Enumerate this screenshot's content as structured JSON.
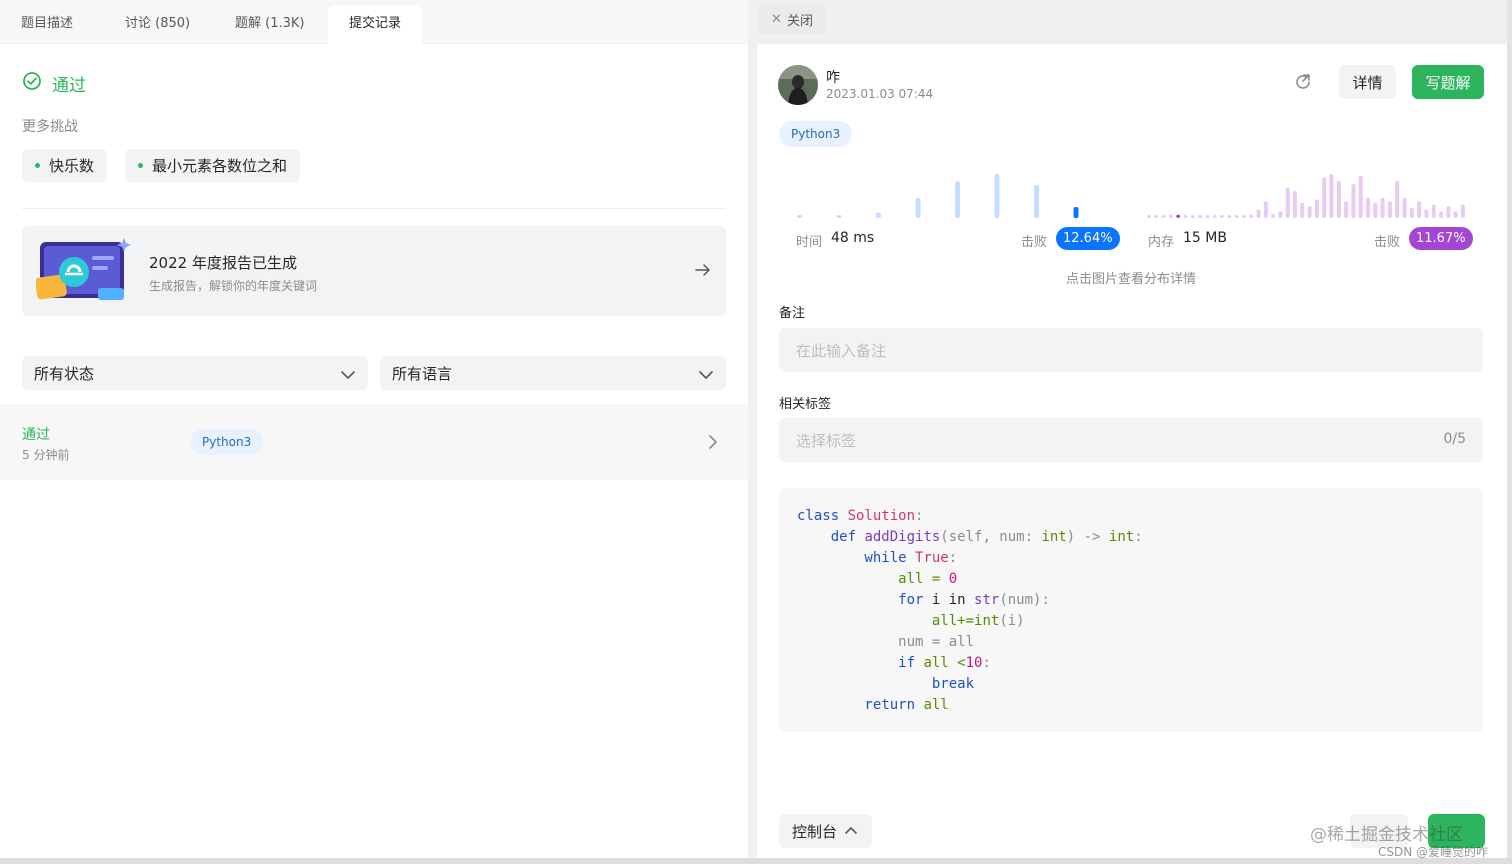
{
  "tabs": [
    {
      "label": "题目描述"
    },
    {
      "label": "讨论 (850)"
    },
    {
      "label": "题解 (1.3K)"
    },
    {
      "label": "提交记录"
    }
  ],
  "close_tab": {
    "label": "关闭"
  },
  "result": {
    "status": "通过",
    "more_challenges_label": "更多挑战",
    "challenges": [
      "快乐数",
      "最小元素各数位之和"
    ]
  },
  "banner": {
    "title": "2022 年度报告已生成",
    "subtitle": "生成报告，解锁你的年度关键词"
  },
  "filters": {
    "status_select": "所有状态",
    "language_select": "所有语言"
  },
  "submission": {
    "status": "通过",
    "time_ago": "5 分钟前",
    "language": "Python3"
  },
  "detail": {
    "username": "咋",
    "datetime": "2023.01.03 07:44",
    "detail_button": "详情",
    "write_solution_button": "写题解",
    "language": "Python3",
    "runtime": {
      "label": "时间",
      "value": "48 ms",
      "beat_label": "击败",
      "beat_value": "12.64%"
    },
    "memory": {
      "label": "内存",
      "value": "15 MB",
      "beat_label": "击败",
      "beat_value": "11.67%"
    },
    "distribution_hint": "点击图片查看分布详情",
    "runtime_histogram": [
      0.05,
      0.05,
      0.15,
      0.55,
      1.0,
      1.2,
      0.9,
      0.3
    ],
    "memory_histogram": [
      0.08,
      0.08,
      0.08,
      0.1,
      0.1,
      0.08,
      0.08,
      0.08,
      0.08,
      0.08,
      0.08,
      0.08,
      0.08,
      0.08,
      0.1,
      0.25,
      0.5,
      0.12,
      0.2,
      0.9,
      0.8,
      0.45,
      0.35,
      0.55,
      1.2,
      1.3,
      1.1,
      0.5,
      1.0,
      1.25,
      0.6,
      0.45,
      0.6,
      0.5,
      1.1,
      0.6,
      0.3,
      0.5,
      0.25,
      0.4,
      0.2,
      0.35,
      0.2,
      0.4
    ],
    "runtime_colors": {
      "bar": "#c5deff",
      "highlight": "#0a73ff"
    },
    "memory_colors": {
      "bar": "#e7cbf5",
      "highlight": "#a446d3"
    },
    "note_label": "备注",
    "note_placeholder": "在此输入备注",
    "tags_label": "相关标签",
    "tags_placeholder": "选择标签",
    "tags_count": "0/5",
    "console_label": "控制台"
  },
  "code_lines": [
    [
      "class ",
      "Solution",
      ":"
    ],
    [
      "    def ",
      "addDigits",
      "(self, num: ",
      "int",
      ") -> ",
      "int",
      ":"
    ],
    [
      "        while ",
      "True",
      ":"
    ],
    [
      "            all = ",
      "0"
    ],
    [
      "            for ",
      "i in ",
      "str",
      "(num):"
    ],
    [
      "                all+=",
      "int",
      "(i)"
    ],
    [
      "            num = all"
    ],
    [
      "            if ",
      "all <",
      "10",
      ":"
    ],
    [
      "                ",
      "break"
    ],
    [
      "        return ",
      "all"
    ]
  ],
  "watermark": {
    "line1": "@稀土掘金技术社区",
    "line2": "CSDN @爱睡觉的咋"
  },
  "colors": {
    "accent_green": "#2db55d",
    "runtime_blue": "#0a73ff",
    "memory_purple": "#a446d3"
  }
}
